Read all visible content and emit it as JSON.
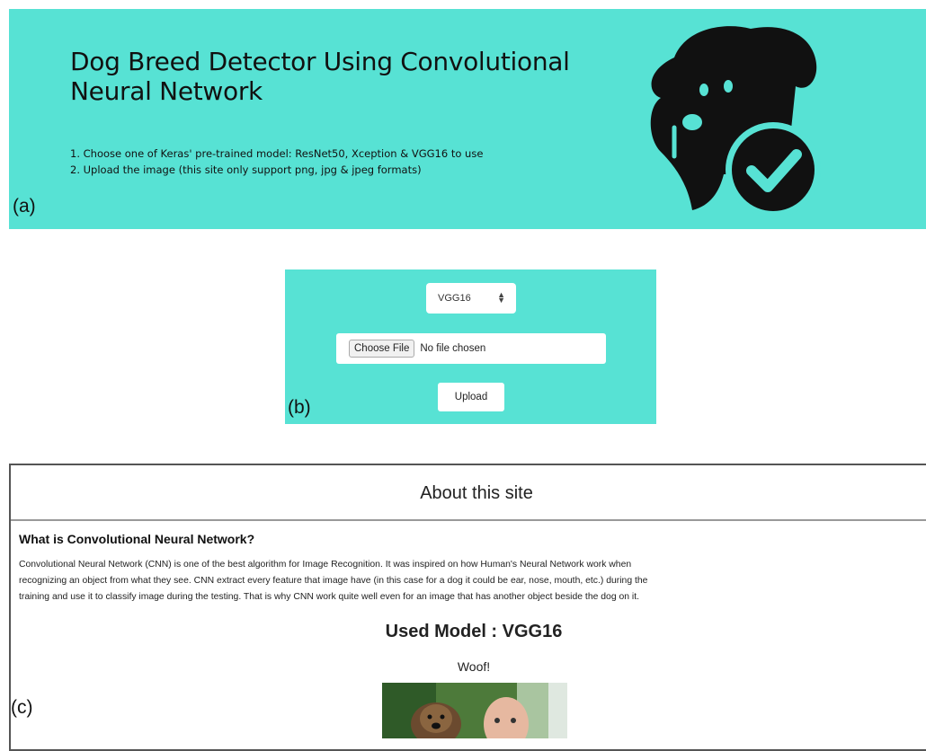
{
  "panel_a": {
    "title": "Dog Breed Detector Using Convolutional Neural Network",
    "steps": [
      "1. Choose one of Keras' pre-trained model: ResNet50, Xception & VGG16 to use",
      "2. Upload the image (this site only support png, jpg & jpeg formats)"
    ],
    "label": "(a)",
    "logo_icon": "dog-check-icon",
    "bg_color": "#57e2d4"
  },
  "panel_b": {
    "model_select_value": "VGG16",
    "choose_file_label": "Choose File",
    "no_file_text": "No file chosen",
    "upload_label": "Upload",
    "label": "(b)"
  },
  "panel_c": {
    "header": "About this site",
    "question": "What is Convolutional Neural Network?",
    "description_lines": [
      "Convolutional Neural Network (CNN) is one of the best algorithm for Image Recognition. It was inspired on how Human's Neural Network work when",
      "recognizing an object from what they see. CNN extract every feature that image have (in this case for a dog it could be ear, nose, mouth, etc.) during the",
      "training and use it to classify image during the testing. That is why CNN work quite well even for an image that has another object beside the dog on it."
    ],
    "used_model": "Used Model : VGG16",
    "result": "Woof!",
    "label": "(c)"
  }
}
